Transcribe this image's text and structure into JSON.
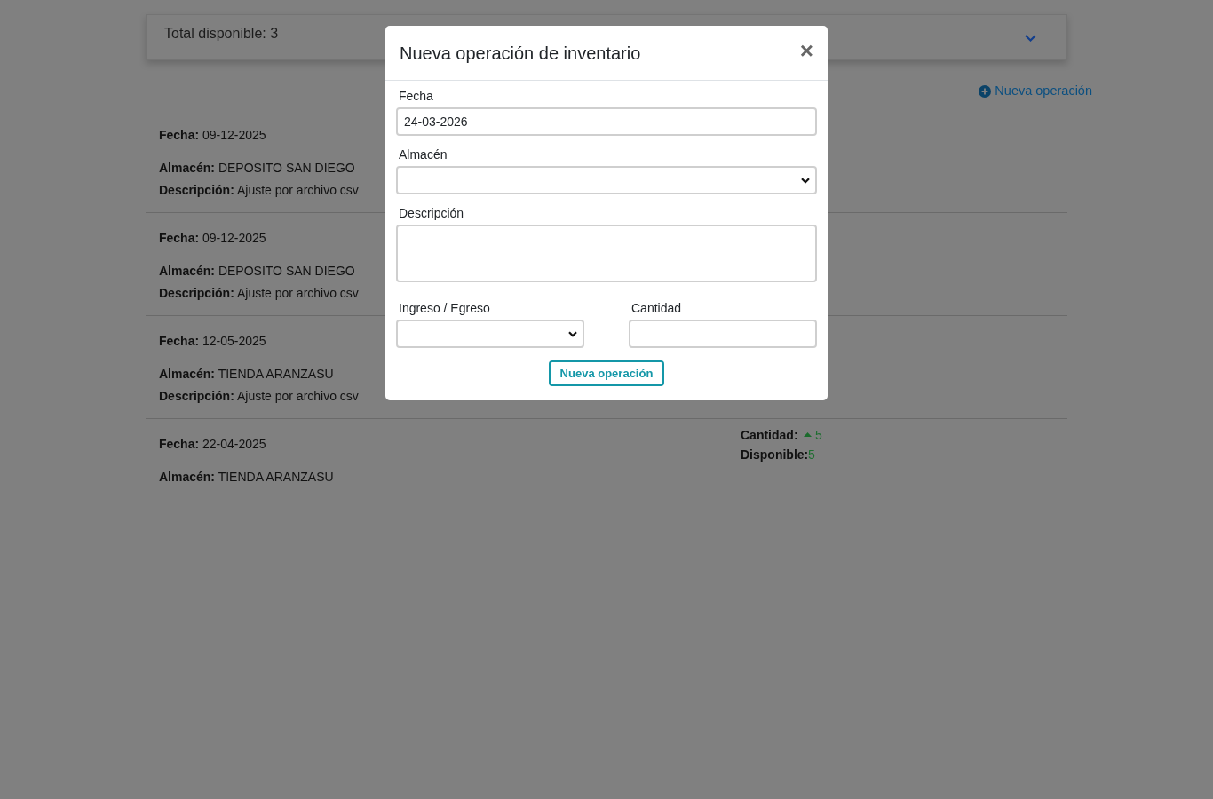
{
  "summary": {
    "label": "Total disponible: 3",
    "expanded": false
  },
  "add_link": {
    "label": "Nueva operación"
  },
  "operations": [
    {
      "lines": [
        "**Fecha:** 09-12-2025",
        "**Almacén:** DEPOSITO SAN DIEGO",
        "**Descripción:** Ajuste por archivo csv"
      ]
    },
    {
      "lines": [
        "**Fecha:** 09-12-2025",
        "**Almacén:** DEPOSITO SAN DIEGO",
        "**Descripción:** Ajuste por archivo csv"
      ]
    },
    {
      "lines": [
        "**Fecha:** 12-05-2025",
        "**Almacén:** TIENDA ARANZASU",
        "**Descripción:** Ajuste por archivo csv"
      ]
    },
    {
      "lines": [
        "**Fecha:** 22-04-2025",
        "**Almacén:** TIENDA ARANZASU"
      ],
      "quantity": {
        "label": "Cantidad:",
        "value": "5",
        "increase": true
      },
      "available": {
        "label": "Disponible:",
        "value": "5"
      }
    }
  ],
  "modal": {
    "title": "Nueva operación de inventario",
    "close": "×",
    "rows": [
      [
        {
          "kind": "text",
          "label": "Fecha",
          "value": "24-03-2026"
        }
      ],
      [
        {
          "kind": "select",
          "label": "Almacén"
        }
      ],
      [
        {
          "kind": "textarea",
          "label": "Descripción"
        }
      ],
      [
        {
          "kind": "select",
          "label": "Ingreso / Egreso"
        },
        {
          "kind": "text",
          "label": "Cantidad"
        }
      ]
    ],
    "submit": "Nueva operación"
  }
}
